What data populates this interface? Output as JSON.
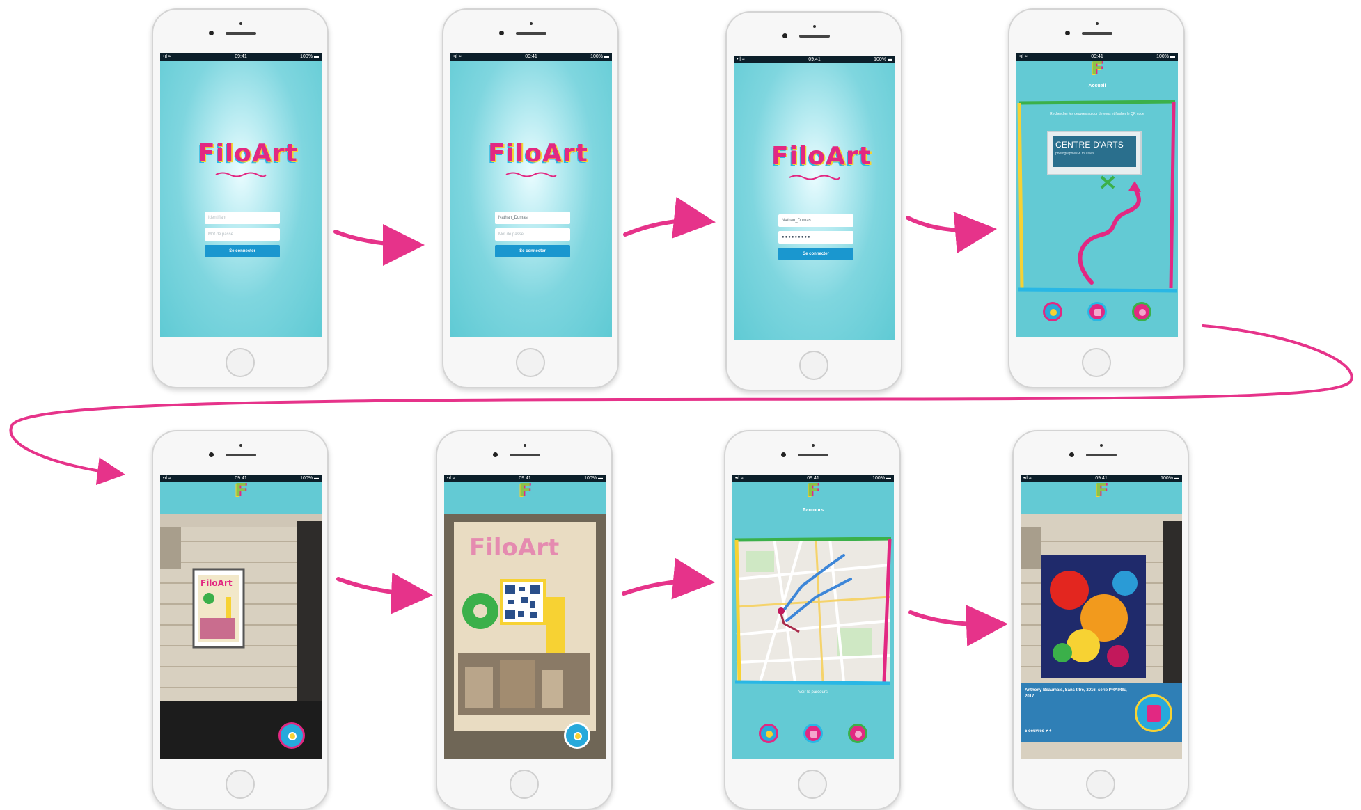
{
  "colors": {
    "arrow": "#e6338a",
    "screen": "#63cad4",
    "button": "#1a97cf",
    "frame_green": "#3bb04a",
    "frame_pink": "#e22882",
    "frame_yellow": "#f7d233",
    "frame_blue": "#29b7e5"
  },
  "phone": {
    "statusbar": {
      "signal": "•ıl ≈",
      "time": "09:41",
      "battery": "100% ▬"
    },
    "logo_text": "FiloArt",
    "f_mark": "F"
  },
  "screens": {
    "login_empty": {
      "username_placeholder": "Identifiant",
      "password_placeholder": "Mot de passe",
      "button": "Se connecter"
    },
    "login_username": {
      "username_value": "Nathan_Dumas",
      "password_placeholder": "Mot de passe",
      "button": "Se connecter"
    },
    "login_password": {
      "username_value": "Nathan_Dumas",
      "password_value": "●●●●●●●●●",
      "button": "Se connecter"
    },
    "home": {
      "title": "Accueil",
      "intro": "Rechercher les oeuvres autour de vous et flasher le QR code",
      "sign_title": "CENTRE D'ARTS",
      "sign_subtitle": "photographies & murales",
      "nav_icons": [
        "scan-icon",
        "museum-icon",
        "location-pin-icon"
      ]
    },
    "map": {
      "title": "Parcours",
      "footer": "Voir le parcours"
    },
    "artwork": {
      "caption": "Anthony Beaumais, Sans titre, 2016, série PRAIRIE, 2017",
      "footer": "5 oeuvres ♥ +"
    }
  }
}
